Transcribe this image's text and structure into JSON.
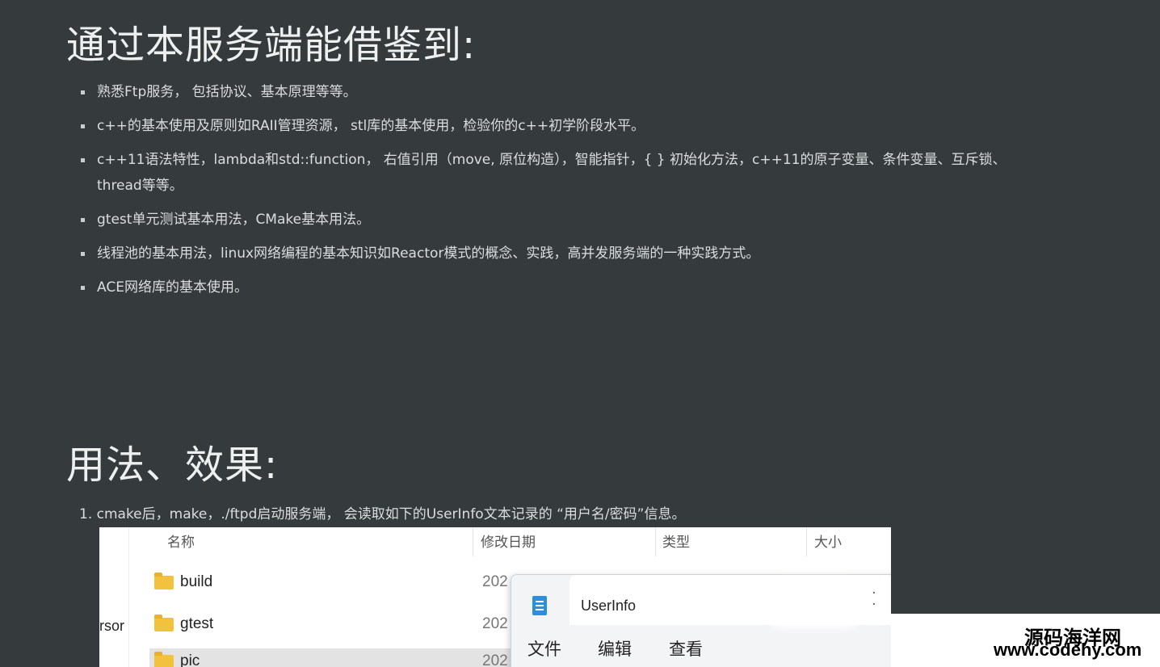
{
  "section1": {
    "title": "通过本服务端能借鉴到:",
    "items": [
      "熟悉Ftp服务， 包括协议、基本原理等等。",
      "c++的基本使用及原则如RAII管理资源， stl库的基本使用，检验你的c++初学阶段水平。",
      "c++11语法特性，lambda和std::function， 右值引用（move, 原位构造），智能指针，{ } 初始化方法，c++11的原子变量、条件变量、互斥锁、thread等等。",
      "gtest单元测试基本用法，CMake基本用法。",
      "线程池的基本用法，linux网络编程的基本知识如Reactor模式的概念、实践，高并发服务端的一种实践方式。",
      "ACE网络库的基本使用。"
    ]
  },
  "section2": {
    "title": "用法、效果:",
    "step1": "1. cmake后，make，./ftpd启动服务端， 会读取如下的UserInfo文本记录的 “用户名/密码”信息。"
  },
  "explorer": {
    "side_text": "rsor",
    "headers": {
      "name": "名称",
      "modified": "修改日期",
      "type": "类型",
      "size": "大小"
    },
    "rows": [
      {
        "name": "build",
        "date": "202"
      },
      {
        "name": "gtest",
        "date": "202"
      },
      {
        "name": "pic",
        "date": "202"
      }
    ]
  },
  "notepad": {
    "title": "UserInfo",
    "menu": {
      "file": "文件",
      "edit": "编辑",
      "view": "查看"
    }
  },
  "watermark": {
    "line1": "源码海洋网",
    "line2": "www.codehy.com"
  }
}
